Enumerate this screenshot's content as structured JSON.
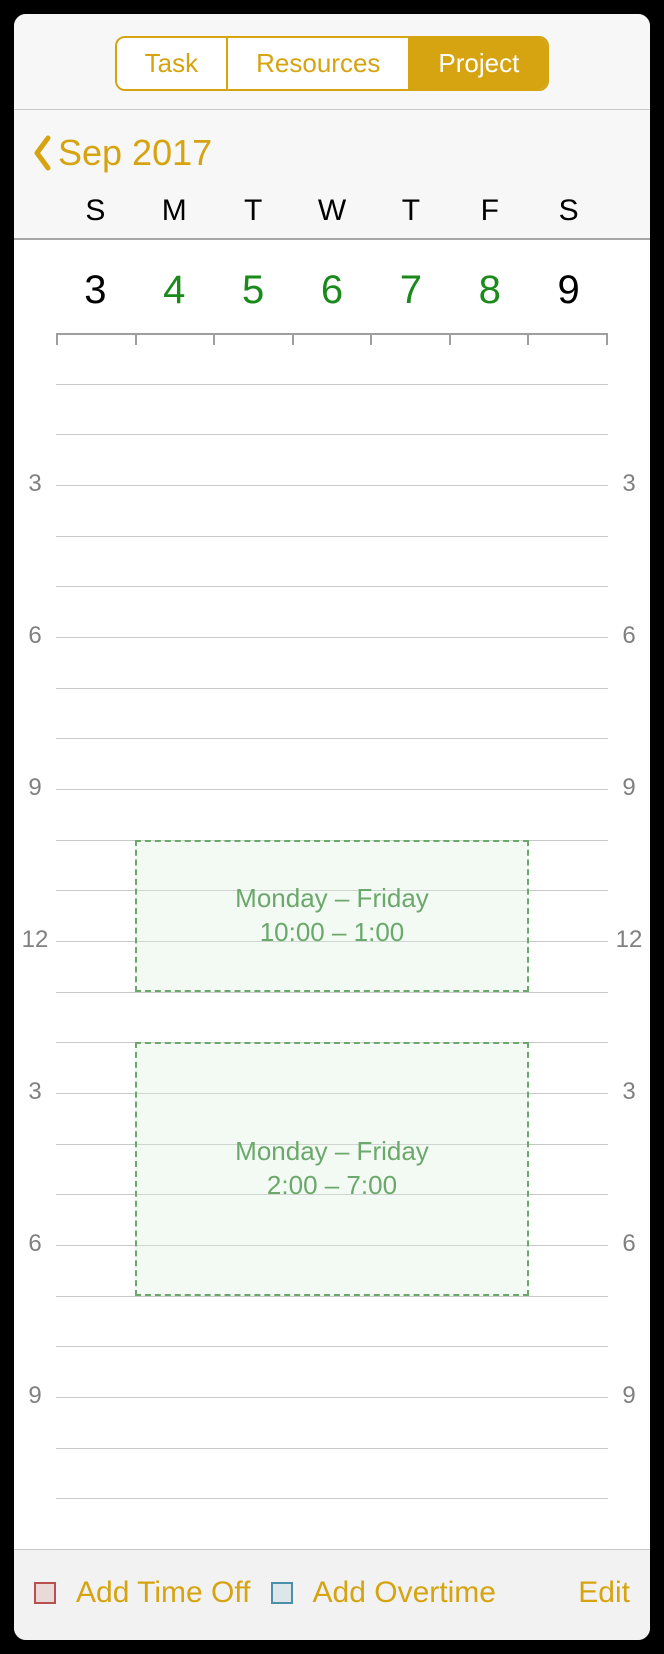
{
  "tabs": {
    "task": "Task",
    "resources": "Resources",
    "project": "Project",
    "active": "project"
  },
  "nav": {
    "month_label": "Sep 2017"
  },
  "weekdays": [
    "S",
    "M",
    "T",
    "W",
    "T",
    "F",
    "S"
  ],
  "dates": [
    {
      "n": "3",
      "work": false
    },
    {
      "n": "4",
      "work": true
    },
    {
      "n": "5",
      "work": true
    },
    {
      "n": "6",
      "work": true
    },
    {
      "n": "7",
      "work": true
    },
    {
      "n": "8",
      "work": true
    },
    {
      "n": "9",
      "work": false
    }
  ],
  "hour_labels": {
    "3a": "3",
    "6a": "6",
    "9a": "9",
    "12": "12",
    "3p": "3",
    "6p": "6",
    "9p": "9"
  },
  "blocks": [
    {
      "title": "Monday – Friday",
      "time": "10:00 – 1:00"
    },
    {
      "title": "Monday – Friday",
      "time": "2:00 – 7:00"
    }
  ],
  "toolbar": {
    "add_time_off": "Add Time Off",
    "add_overtime": "Add Overtime",
    "edit": "Edit"
  }
}
